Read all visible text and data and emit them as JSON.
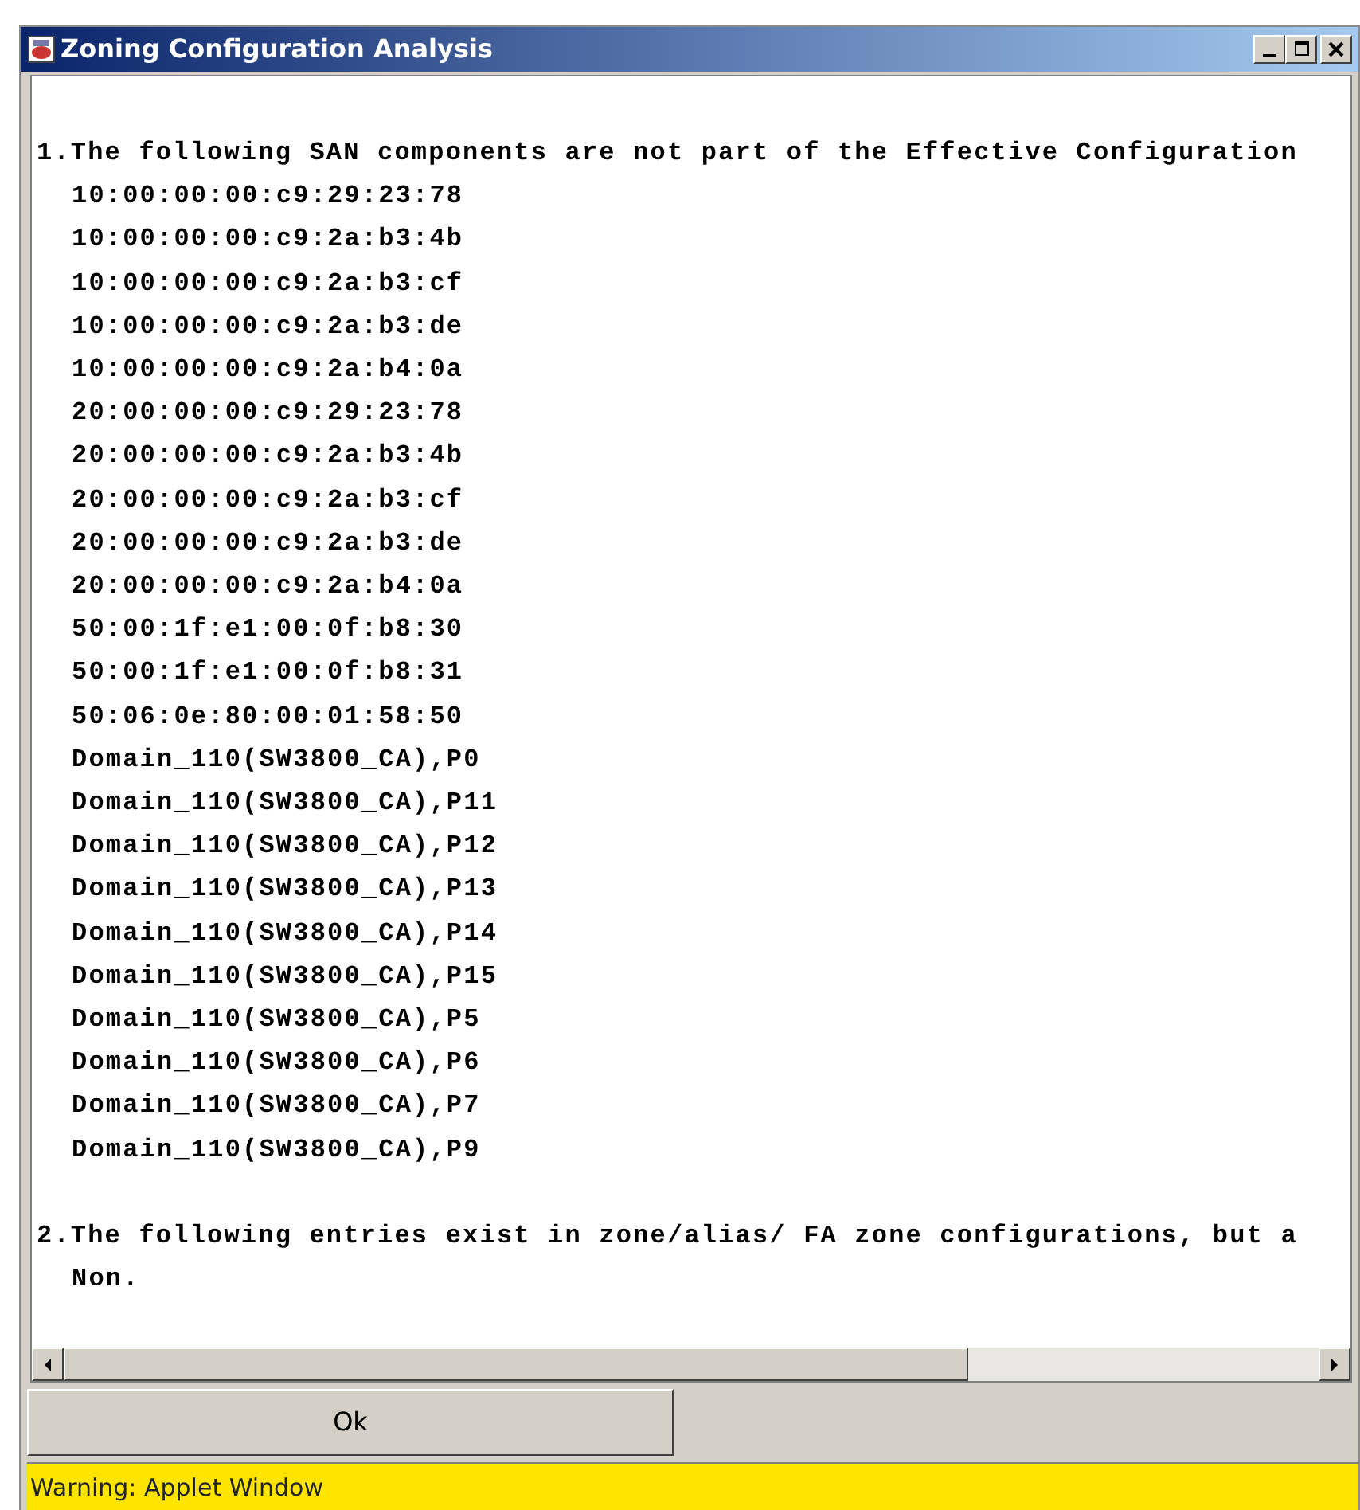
{
  "window": {
    "title": "Zoning Configuration Analysis"
  },
  "report": [
    {
      "kind": "heading",
      "text": "1.The following SAN components are not part of the Effective Configuration"
    },
    {
      "kind": "item",
      "text": "10:00:00:00:c9:29:23:78"
    },
    {
      "kind": "item",
      "text": "10:00:00:00:c9:2a:b3:4b"
    },
    {
      "kind": "item",
      "text": "10:00:00:00:c9:2a:b3:cf"
    },
    {
      "kind": "item",
      "text": "10:00:00:00:c9:2a:b3:de"
    },
    {
      "kind": "item",
      "text": "10:00:00:00:c9:2a:b4:0a"
    },
    {
      "kind": "item",
      "text": "20:00:00:00:c9:29:23:78"
    },
    {
      "kind": "item",
      "text": "20:00:00:00:c9:2a:b3:4b"
    },
    {
      "kind": "item",
      "text": "20:00:00:00:c9:2a:b3:cf"
    },
    {
      "kind": "item",
      "text": "20:00:00:00:c9:2a:b3:de"
    },
    {
      "kind": "item",
      "text": "20:00:00:00:c9:2a:b4:0a"
    },
    {
      "kind": "item",
      "text": "50:00:1f:e1:00:0f:b8:30"
    },
    {
      "kind": "item",
      "text": "50:00:1f:e1:00:0f:b8:31"
    },
    {
      "kind": "item",
      "text": "50:06:0e:80:00:01:58:50"
    },
    {
      "kind": "item",
      "text": "Domain_110(SW3800_CA),P0"
    },
    {
      "kind": "item",
      "text": "Domain_110(SW3800_CA),P11"
    },
    {
      "kind": "item",
      "text": "Domain_110(SW3800_CA),P12"
    },
    {
      "kind": "item",
      "text": "Domain_110(SW3800_CA),P13"
    },
    {
      "kind": "item",
      "text": "Domain_110(SW3800_CA),P14"
    },
    {
      "kind": "item",
      "text": "Domain_110(SW3800_CA),P15"
    },
    {
      "kind": "item",
      "text": "Domain_110(SW3800_CA),P5"
    },
    {
      "kind": "item",
      "text": "Domain_110(SW3800_CA),P6"
    },
    {
      "kind": "item",
      "text": "Domain_110(SW3800_CA),P7"
    },
    {
      "kind": "item",
      "text": "Domain_110(SW3800_CA),P9"
    },
    {
      "kind": "spacer"
    },
    {
      "kind": "heading",
      "text": "2.The following entries exist in zone/alias/ FA zone configurations, but a"
    },
    {
      "kind": "item",
      "text": "Non."
    }
  ],
  "buttons": [
    {
      "label": "Ok"
    }
  ],
  "status_bar": "Warning: Applet Window"
}
